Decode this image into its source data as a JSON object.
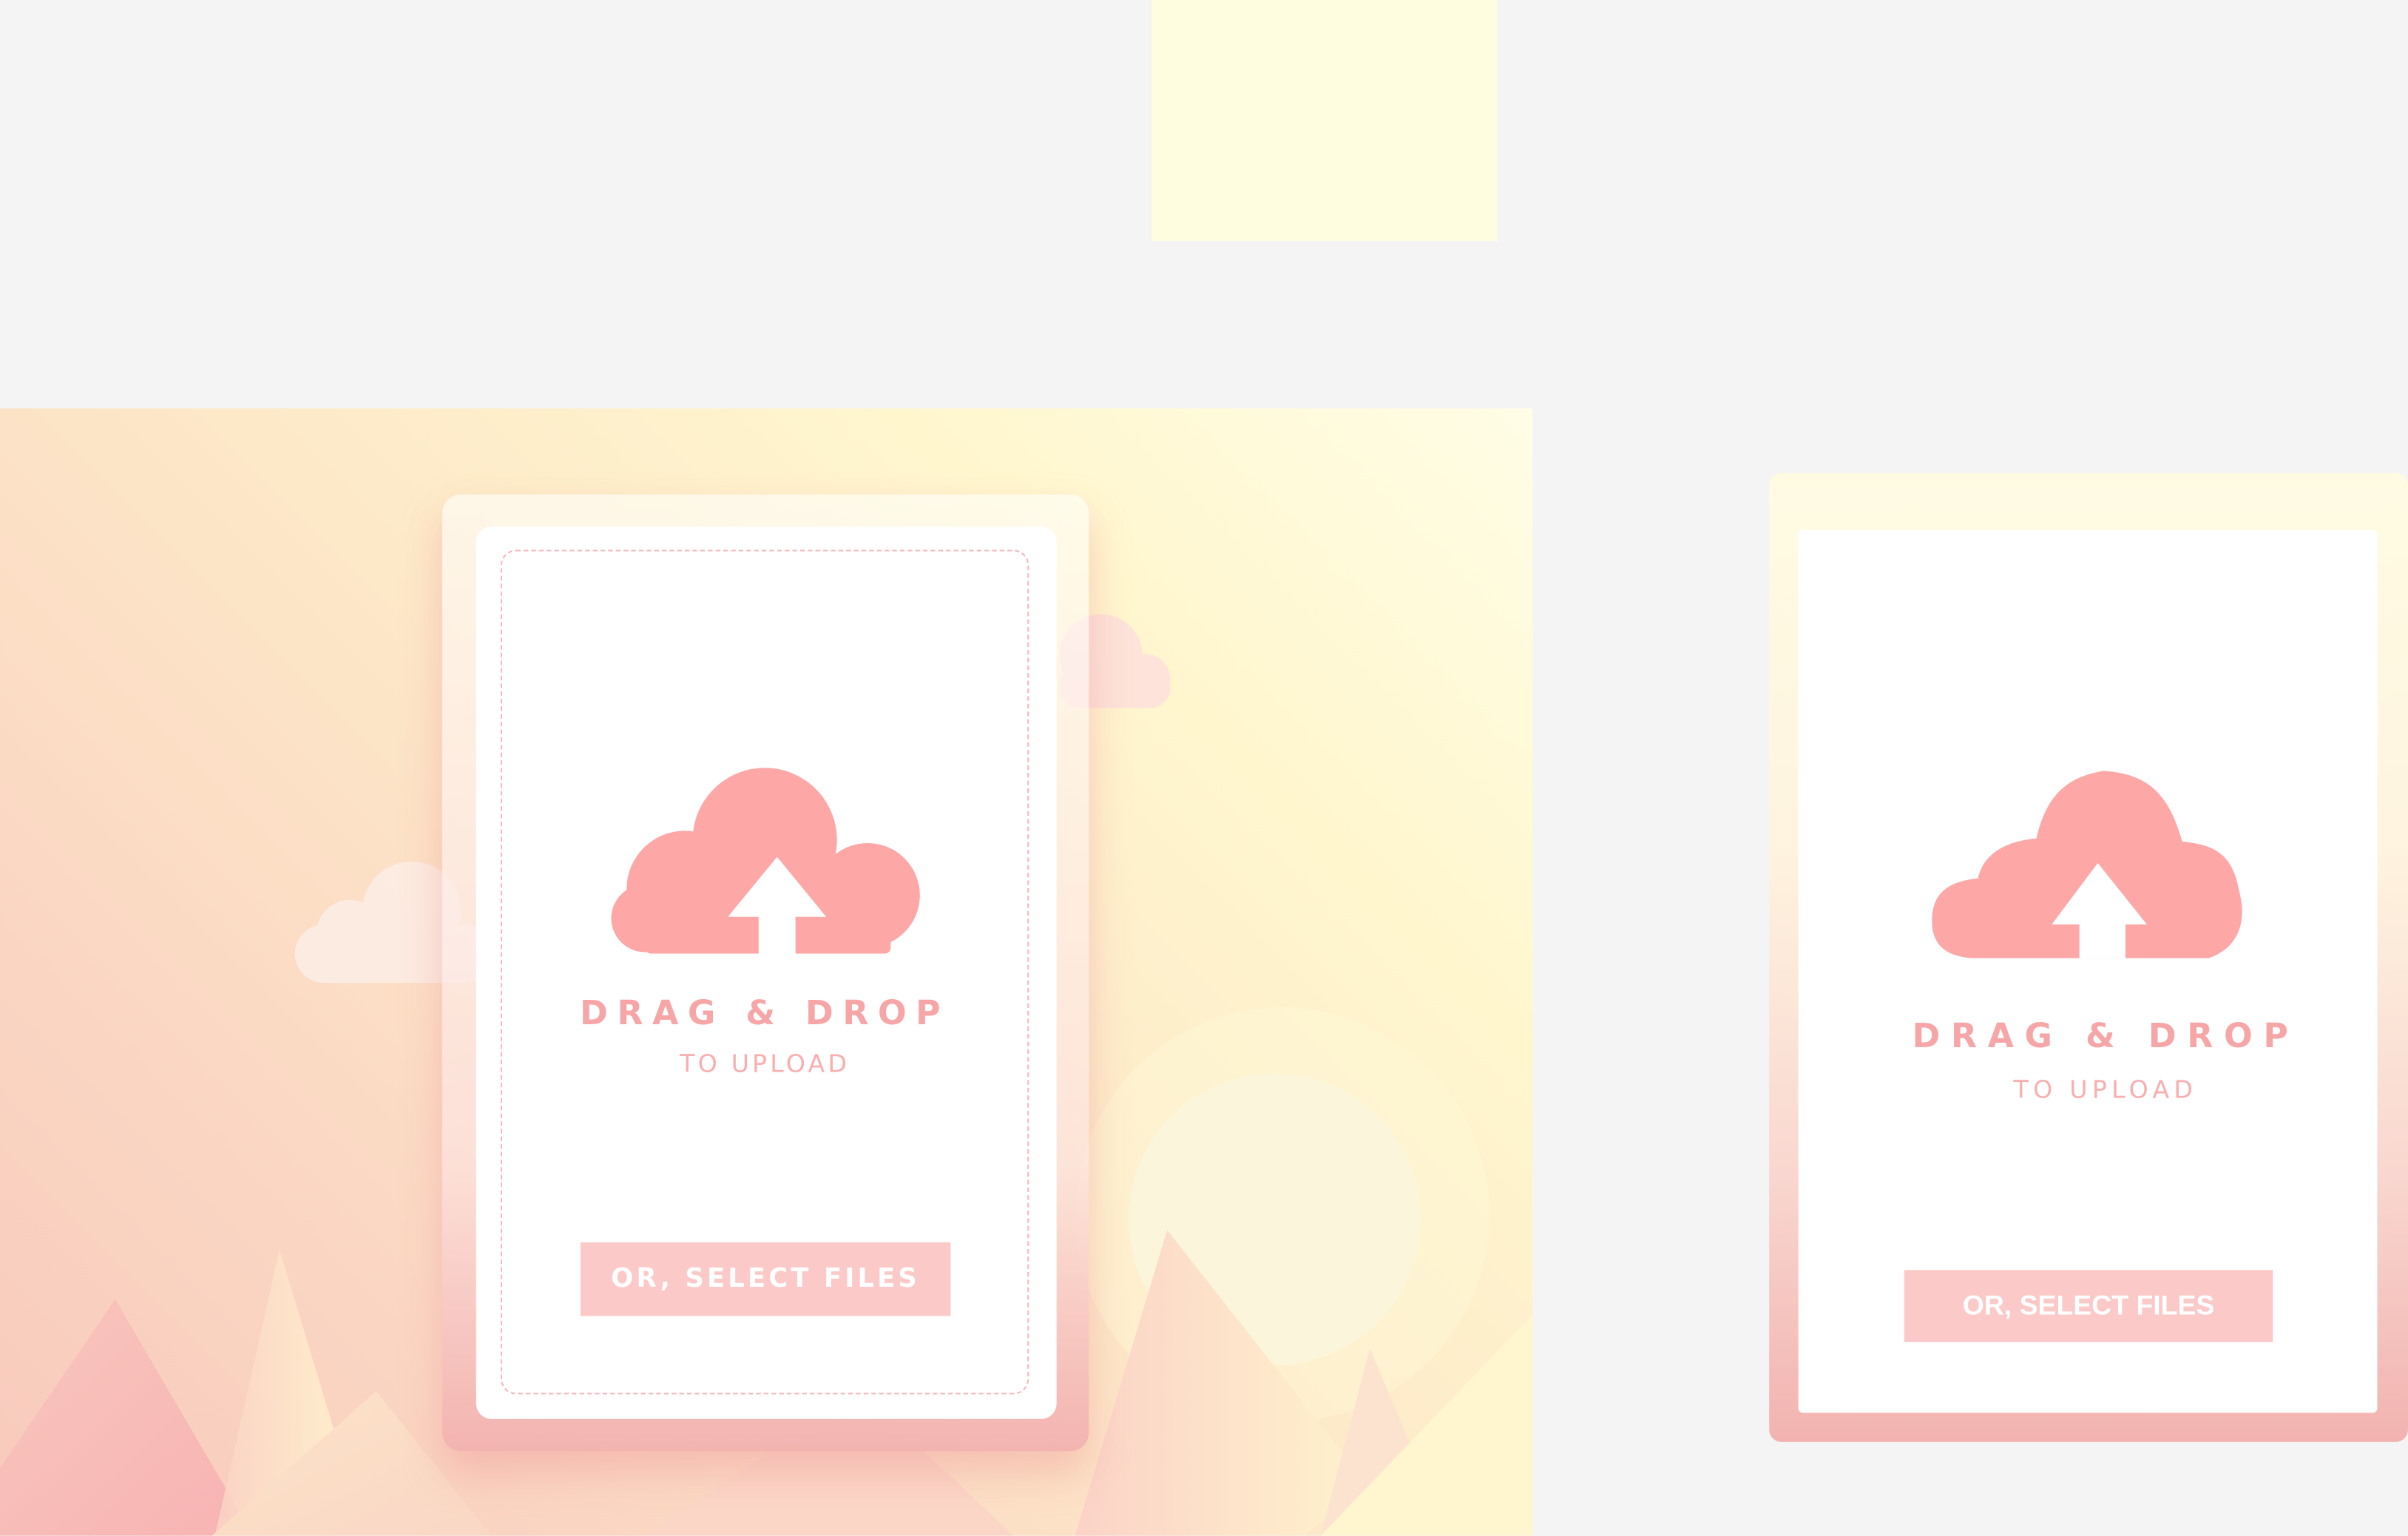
{
  "upload_cards": [
    {
      "title": "DRAG & DROP",
      "subtitle": "TO UPLOAD",
      "button_label": "OR, SELECT FILES",
      "icon": "cloud-upload-icon"
    },
    {
      "title": "DRAG & DROP",
      "subtitle": "TO UPLOAD",
      "button_label": "OR, SELECT FILES",
      "icon": "cloud-upload-icon"
    }
  ],
  "colors": {
    "background": "#f4f4f4",
    "swatch": "#fffde0",
    "accent_pink": "#f7a6a8",
    "button_pink": "#fcc9c9",
    "icon_pink": "#fda7a7",
    "card_white": "#ffffff"
  }
}
